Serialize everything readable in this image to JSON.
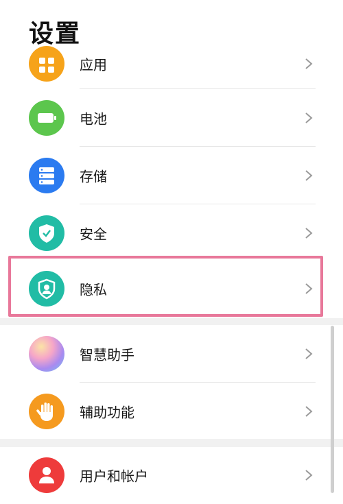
{
  "header": {
    "title": "设置"
  },
  "settings": {
    "items": [
      {
        "label": "应用",
        "icon": "apps-icon",
        "color": "#f6a31a"
      },
      {
        "label": "电池",
        "icon": "battery-icon",
        "color": "#5cc64d"
      },
      {
        "label": "存储",
        "icon": "storage-icon",
        "color": "#2b7bf0"
      },
      {
        "label": "安全",
        "icon": "shield-check-icon",
        "color": "#21bca5"
      },
      {
        "label": "隐私",
        "icon": "privacy-shield-user-icon",
        "color": "#21bca5"
      },
      {
        "label": "智慧助手",
        "icon": "assistant-orb-icon",
        "color": "#c079e6"
      },
      {
        "label": "辅助功能",
        "icon": "hand-icon",
        "color": "#f59a1f"
      },
      {
        "label": "用户和帐户",
        "icon": "user-icon",
        "color": "#ee3b3b"
      }
    ]
  },
  "highlight_color": "#e8789a"
}
